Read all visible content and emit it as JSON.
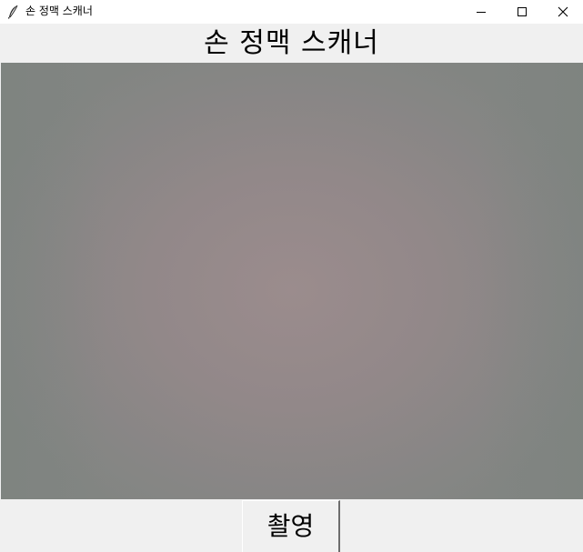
{
  "window": {
    "title": "손 정맥 스캐너",
    "controls": {
      "minimize_icon": "minimize-icon",
      "maximize_icon": "maximize-icon",
      "close_icon": "close-icon"
    }
  },
  "header": {
    "title": "손 정맥 스캐너"
  },
  "main": {
    "camera_feed": {
      "icon": "camera-feed"
    }
  },
  "actions": {
    "capture_label": "촬영"
  },
  "colors": {
    "window_bg": "#f0f0f0",
    "titlebar_bg": "#ffffff",
    "feed_center": "#9b8c8d",
    "feed_edge": "#828582"
  }
}
